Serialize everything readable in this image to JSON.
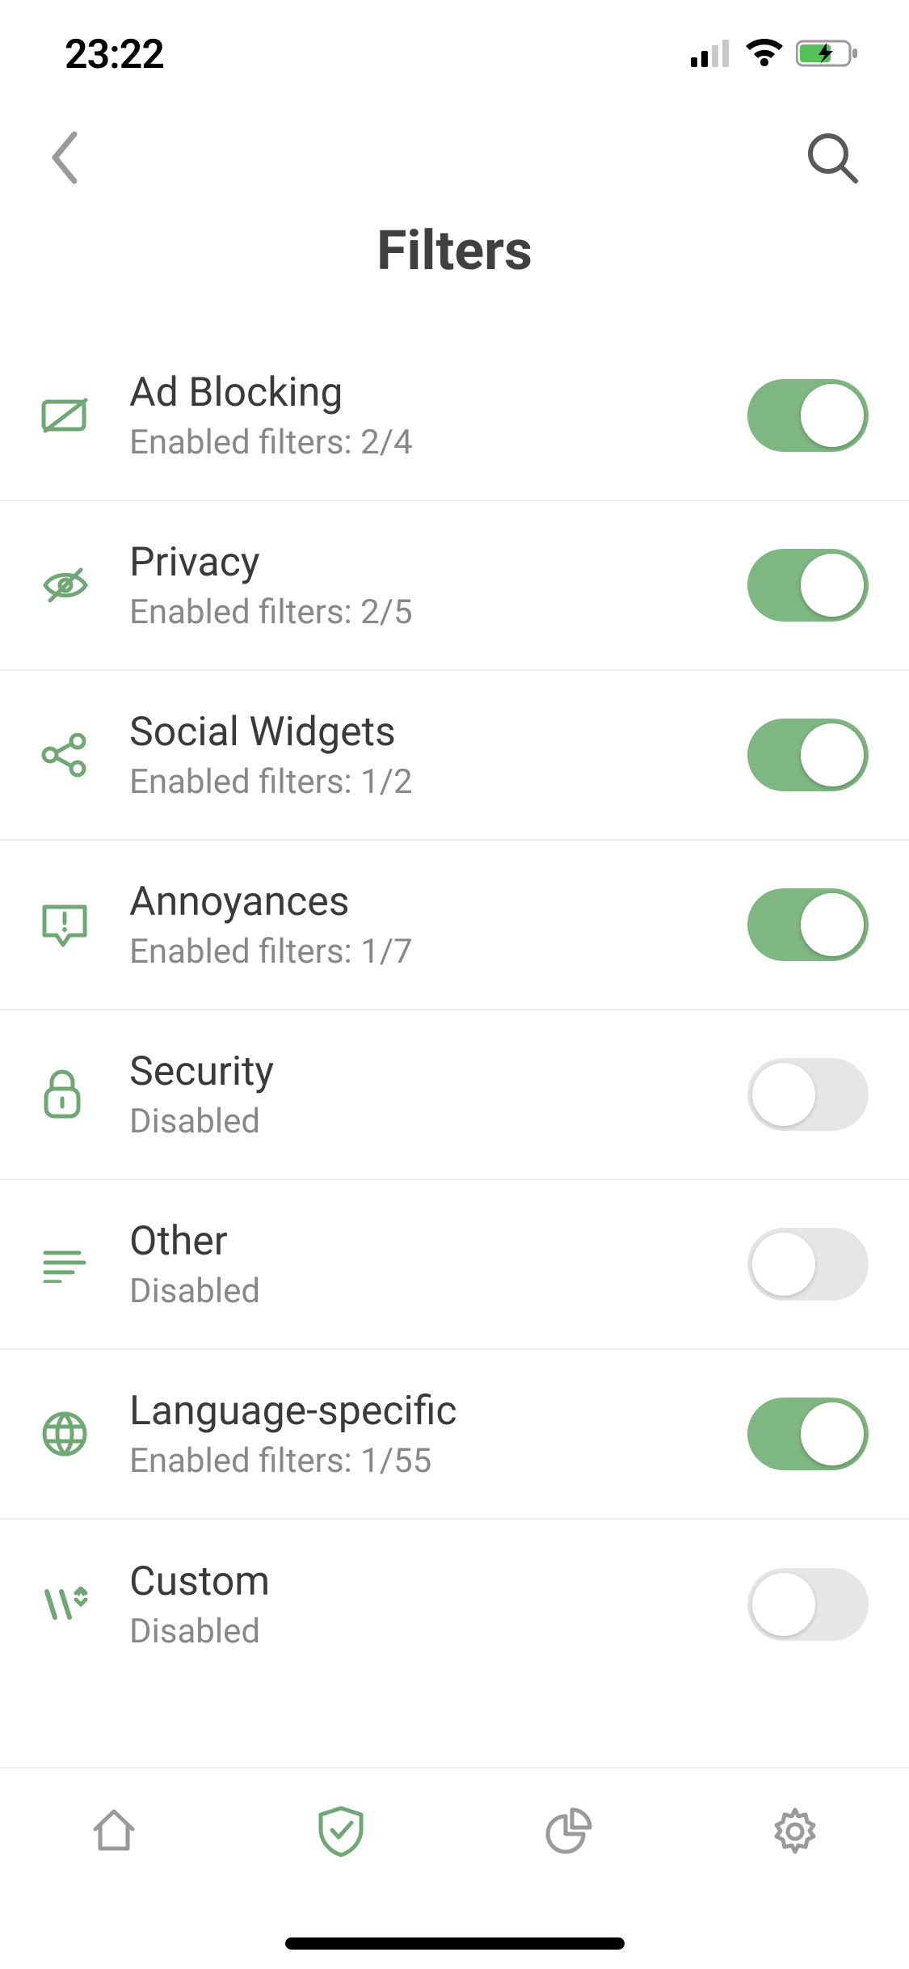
{
  "status": {
    "time": "23:22"
  },
  "colors": {
    "accent": "#7fb782",
    "iconGreen": "#6fa874",
    "grayIcon": "#9a9a9a",
    "title": "#404040",
    "subtitle": "#888888"
  },
  "header": {
    "title": "Filters"
  },
  "filters": [
    {
      "id": "ad-blocking",
      "icon": "ad-block-icon",
      "title": "Ad Blocking",
      "sub": "Enabled filters: 2/4",
      "on": true
    },
    {
      "id": "privacy",
      "icon": "eye-off-icon",
      "title": "Privacy",
      "sub": "Enabled filters: 2/5",
      "on": true
    },
    {
      "id": "social-widgets",
      "icon": "share-icon",
      "title": "Social Widgets",
      "sub": "Enabled filters: 1/2",
      "on": true
    },
    {
      "id": "annoyances",
      "icon": "annoyance-icon",
      "title": "Annoyances",
      "sub": "Enabled filters: 1/7",
      "on": true
    },
    {
      "id": "security",
      "icon": "lock-icon",
      "title": "Security",
      "sub": "Disabled",
      "on": false
    },
    {
      "id": "other",
      "icon": "lines-icon",
      "title": "Other",
      "sub": "Disabled",
      "on": false
    },
    {
      "id": "language-specific",
      "icon": "globe-icon",
      "title": "Language-specific",
      "sub": "Enabled filters: 1/55",
      "on": true
    },
    {
      "id": "custom",
      "icon": "code-icon",
      "title": "Custom",
      "sub": "Disabled",
      "on": false
    }
  ]
}
